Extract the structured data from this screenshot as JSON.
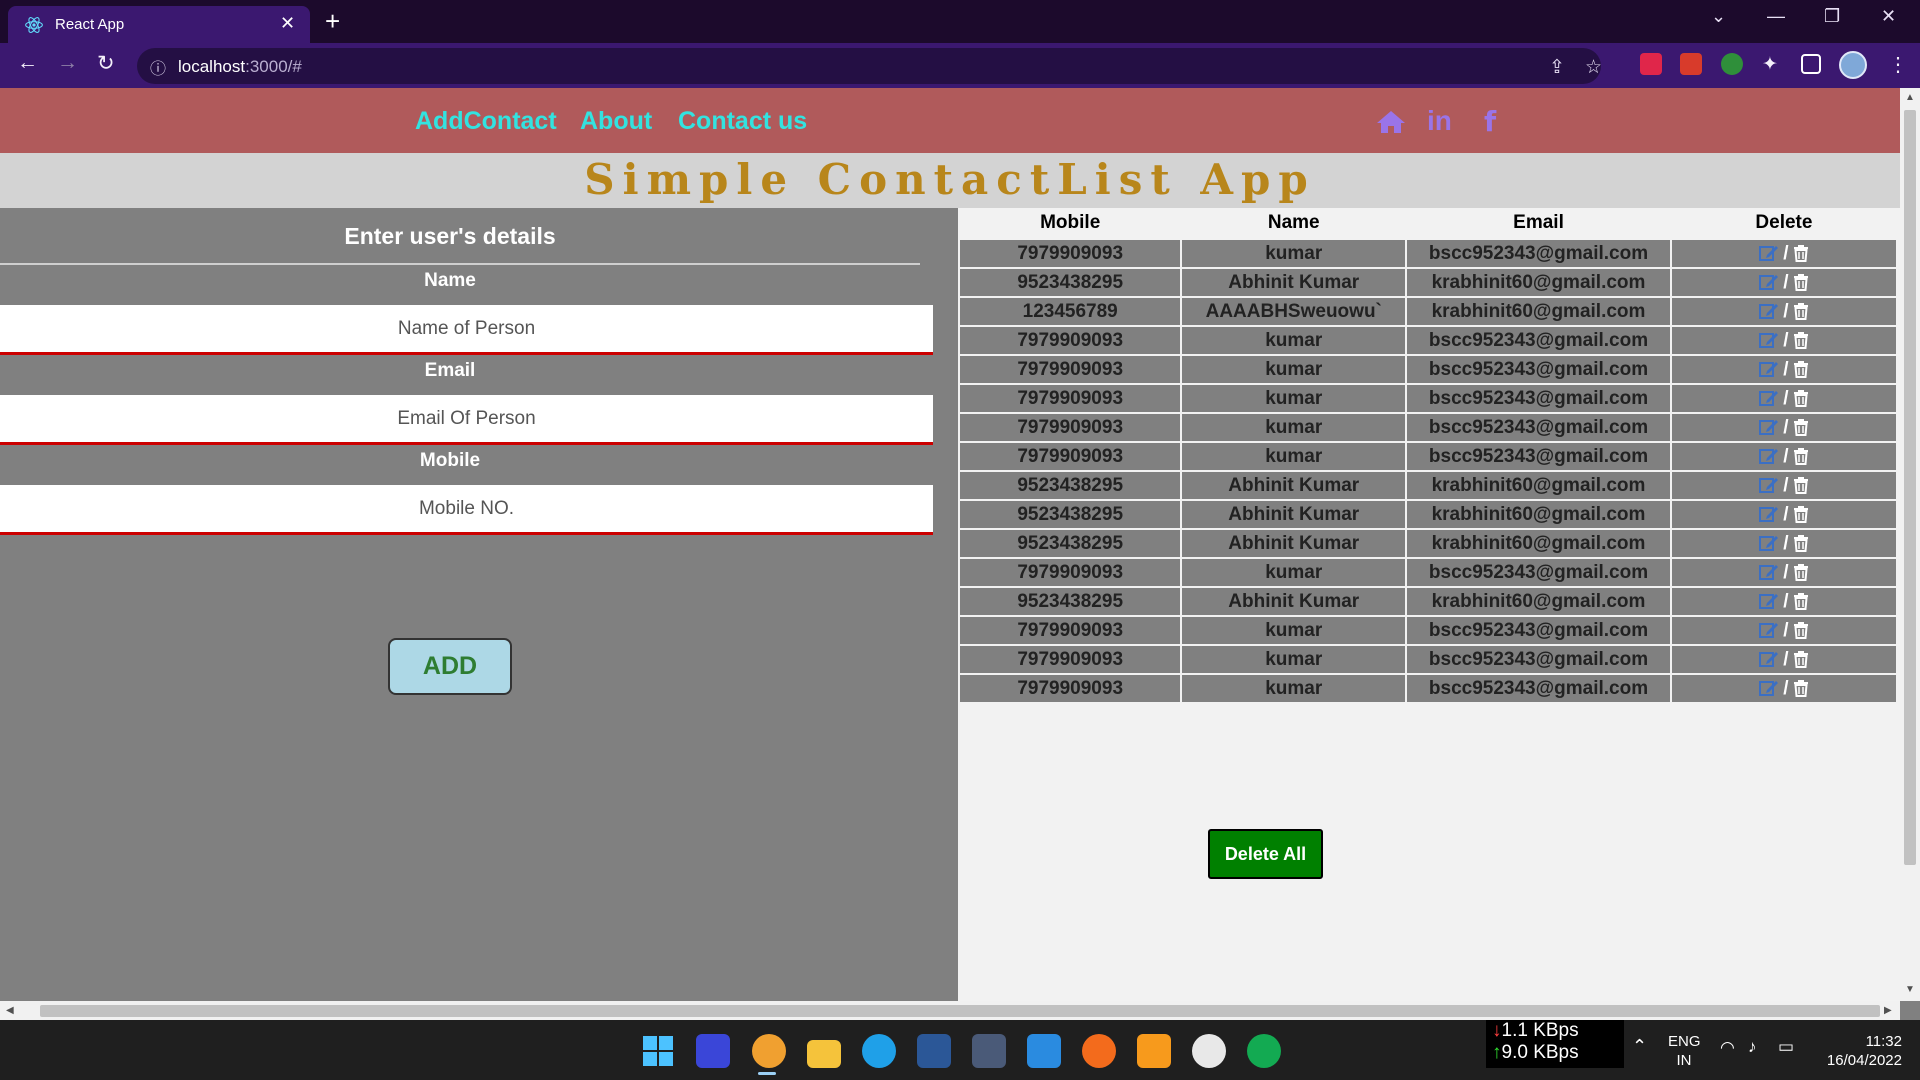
{
  "browser": {
    "tab_title": "React App",
    "url_host": "localhost",
    "url_path": ":3000/#"
  },
  "header": {
    "nav": [
      "AddContact",
      "About",
      "Contact us"
    ],
    "social_icons": [
      "home-icon",
      "linkedin-icon",
      "facebook-icon"
    ]
  },
  "app_title": "Simple ContactList App",
  "form": {
    "title": "Enter user's details",
    "name_label": "Name",
    "name_placeholder": "Name of Person",
    "email_label": "Email",
    "email_placeholder": "Email Of Person",
    "mobile_label": "Mobile",
    "mobile_placeholder": "Mobile NO.",
    "add_label": "ADD"
  },
  "table": {
    "headers": [
      "Mobile",
      "Name",
      "Email",
      "Delete"
    ],
    "action_separator": "/",
    "rows": [
      {
        "mobile": "7979909093",
        "name": "kumar",
        "email": "bscc952343@gmail.com"
      },
      {
        "mobile": "9523438295",
        "name": "Abhinit Kumar",
        "email": "krabhinit60@gmail.com"
      },
      {
        "mobile": "123456789",
        "name": "AAAABHSweuowu`",
        "email": "krabhinit60@gmail.com"
      },
      {
        "mobile": "7979909093",
        "name": "kumar",
        "email": "bscc952343@gmail.com"
      },
      {
        "mobile": "7979909093",
        "name": "kumar",
        "email": "bscc952343@gmail.com"
      },
      {
        "mobile": "7979909093",
        "name": "kumar",
        "email": "bscc952343@gmail.com"
      },
      {
        "mobile": "7979909093",
        "name": "kumar",
        "email": "bscc952343@gmail.com"
      },
      {
        "mobile": "7979909093",
        "name": "kumar",
        "email": "bscc952343@gmail.com"
      },
      {
        "mobile": "9523438295",
        "name": "Abhinit Kumar",
        "email": "krabhinit60@gmail.com"
      },
      {
        "mobile": "9523438295",
        "name": "Abhinit Kumar",
        "email": "krabhinit60@gmail.com"
      },
      {
        "mobile": "9523438295",
        "name": "Abhinit Kumar",
        "email": "krabhinit60@gmail.com"
      },
      {
        "mobile": "7979909093",
        "name": "kumar",
        "email": "bscc952343@gmail.com"
      },
      {
        "mobile": "9523438295",
        "name": "Abhinit Kumar",
        "email": "krabhinit60@gmail.com"
      },
      {
        "mobile": "7979909093",
        "name": "kumar",
        "email": "bscc952343@gmail.com"
      },
      {
        "mobile": "7979909093",
        "name": "kumar",
        "email": "bscc952343@gmail.com"
      },
      {
        "mobile": "7979909093",
        "name": "kumar",
        "email": "bscc952343@gmail.com"
      }
    ]
  },
  "delete_all_label": "Delete All",
  "taskbar": {
    "net_down": "1.1 KBps",
    "net_up": "9.0 KBps",
    "lang": "ENG",
    "region": "IN",
    "time": "11:32",
    "date": "16/04/2022"
  },
  "colors": {
    "header_bg": "#b05a5b",
    "nav_link": "#32e3e0",
    "social_icon": "#9a74e8",
    "title_text": "#b8861b",
    "panel_bg": "#808080",
    "field_border": "#cc0000",
    "add_button": "#add8e6",
    "delete_all": "#008000"
  }
}
